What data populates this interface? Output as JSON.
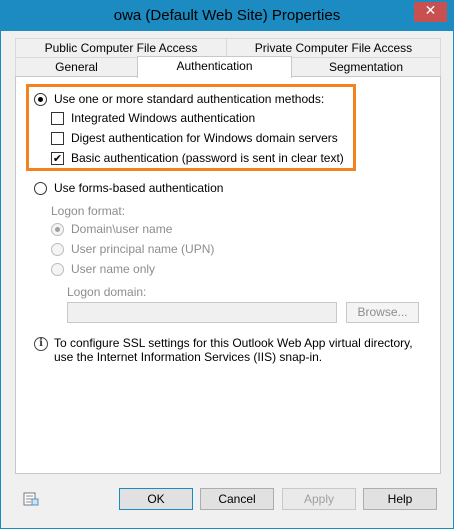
{
  "window": {
    "title": "owa (Default Web Site) Properties",
    "close_glyph": "✕"
  },
  "tabs": {
    "row1": [
      "Public Computer File Access",
      "Private Computer File Access"
    ],
    "row2": [
      "General",
      "Authentication",
      "Segmentation"
    ],
    "active": "Authentication"
  },
  "auth": {
    "standard_methods": {
      "label": "Use one or more standard authentication methods:",
      "selected": true
    },
    "integrated_windows": {
      "label": "Integrated Windows authentication",
      "checked": false
    },
    "digest": {
      "label": "Digest authentication for Windows domain servers",
      "checked": false
    },
    "basic": {
      "label": "Basic authentication (password is sent in clear text)",
      "checked": true
    },
    "forms_based": {
      "label": "Use forms-based authentication",
      "selected": false
    },
    "logon_format": {
      "label": "Logon format:",
      "options": [
        "Domain\\user name",
        "User principal name (UPN)",
        "User name only"
      ],
      "selected": "Domain\\user name"
    },
    "logon_domain": {
      "label": "Logon domain:",
      "value": ""
    },
    "browse_label": "Browse..."
  },
  "info": {
    "icon": "info-icon",
    "text": "To configure SSL settings for this Outlook Web App virtual directory, use the Internet Information Services (IIS) snap-in."
  },
  "buttons": {
    "ok": "OK",
    "cancel": "Cancel",
    "apply": "Apply",
    "help": "Help"
  },
  "colors": {
    "accent": "#1b8bc2",
    "highlight": "#f58220"
  }
}
